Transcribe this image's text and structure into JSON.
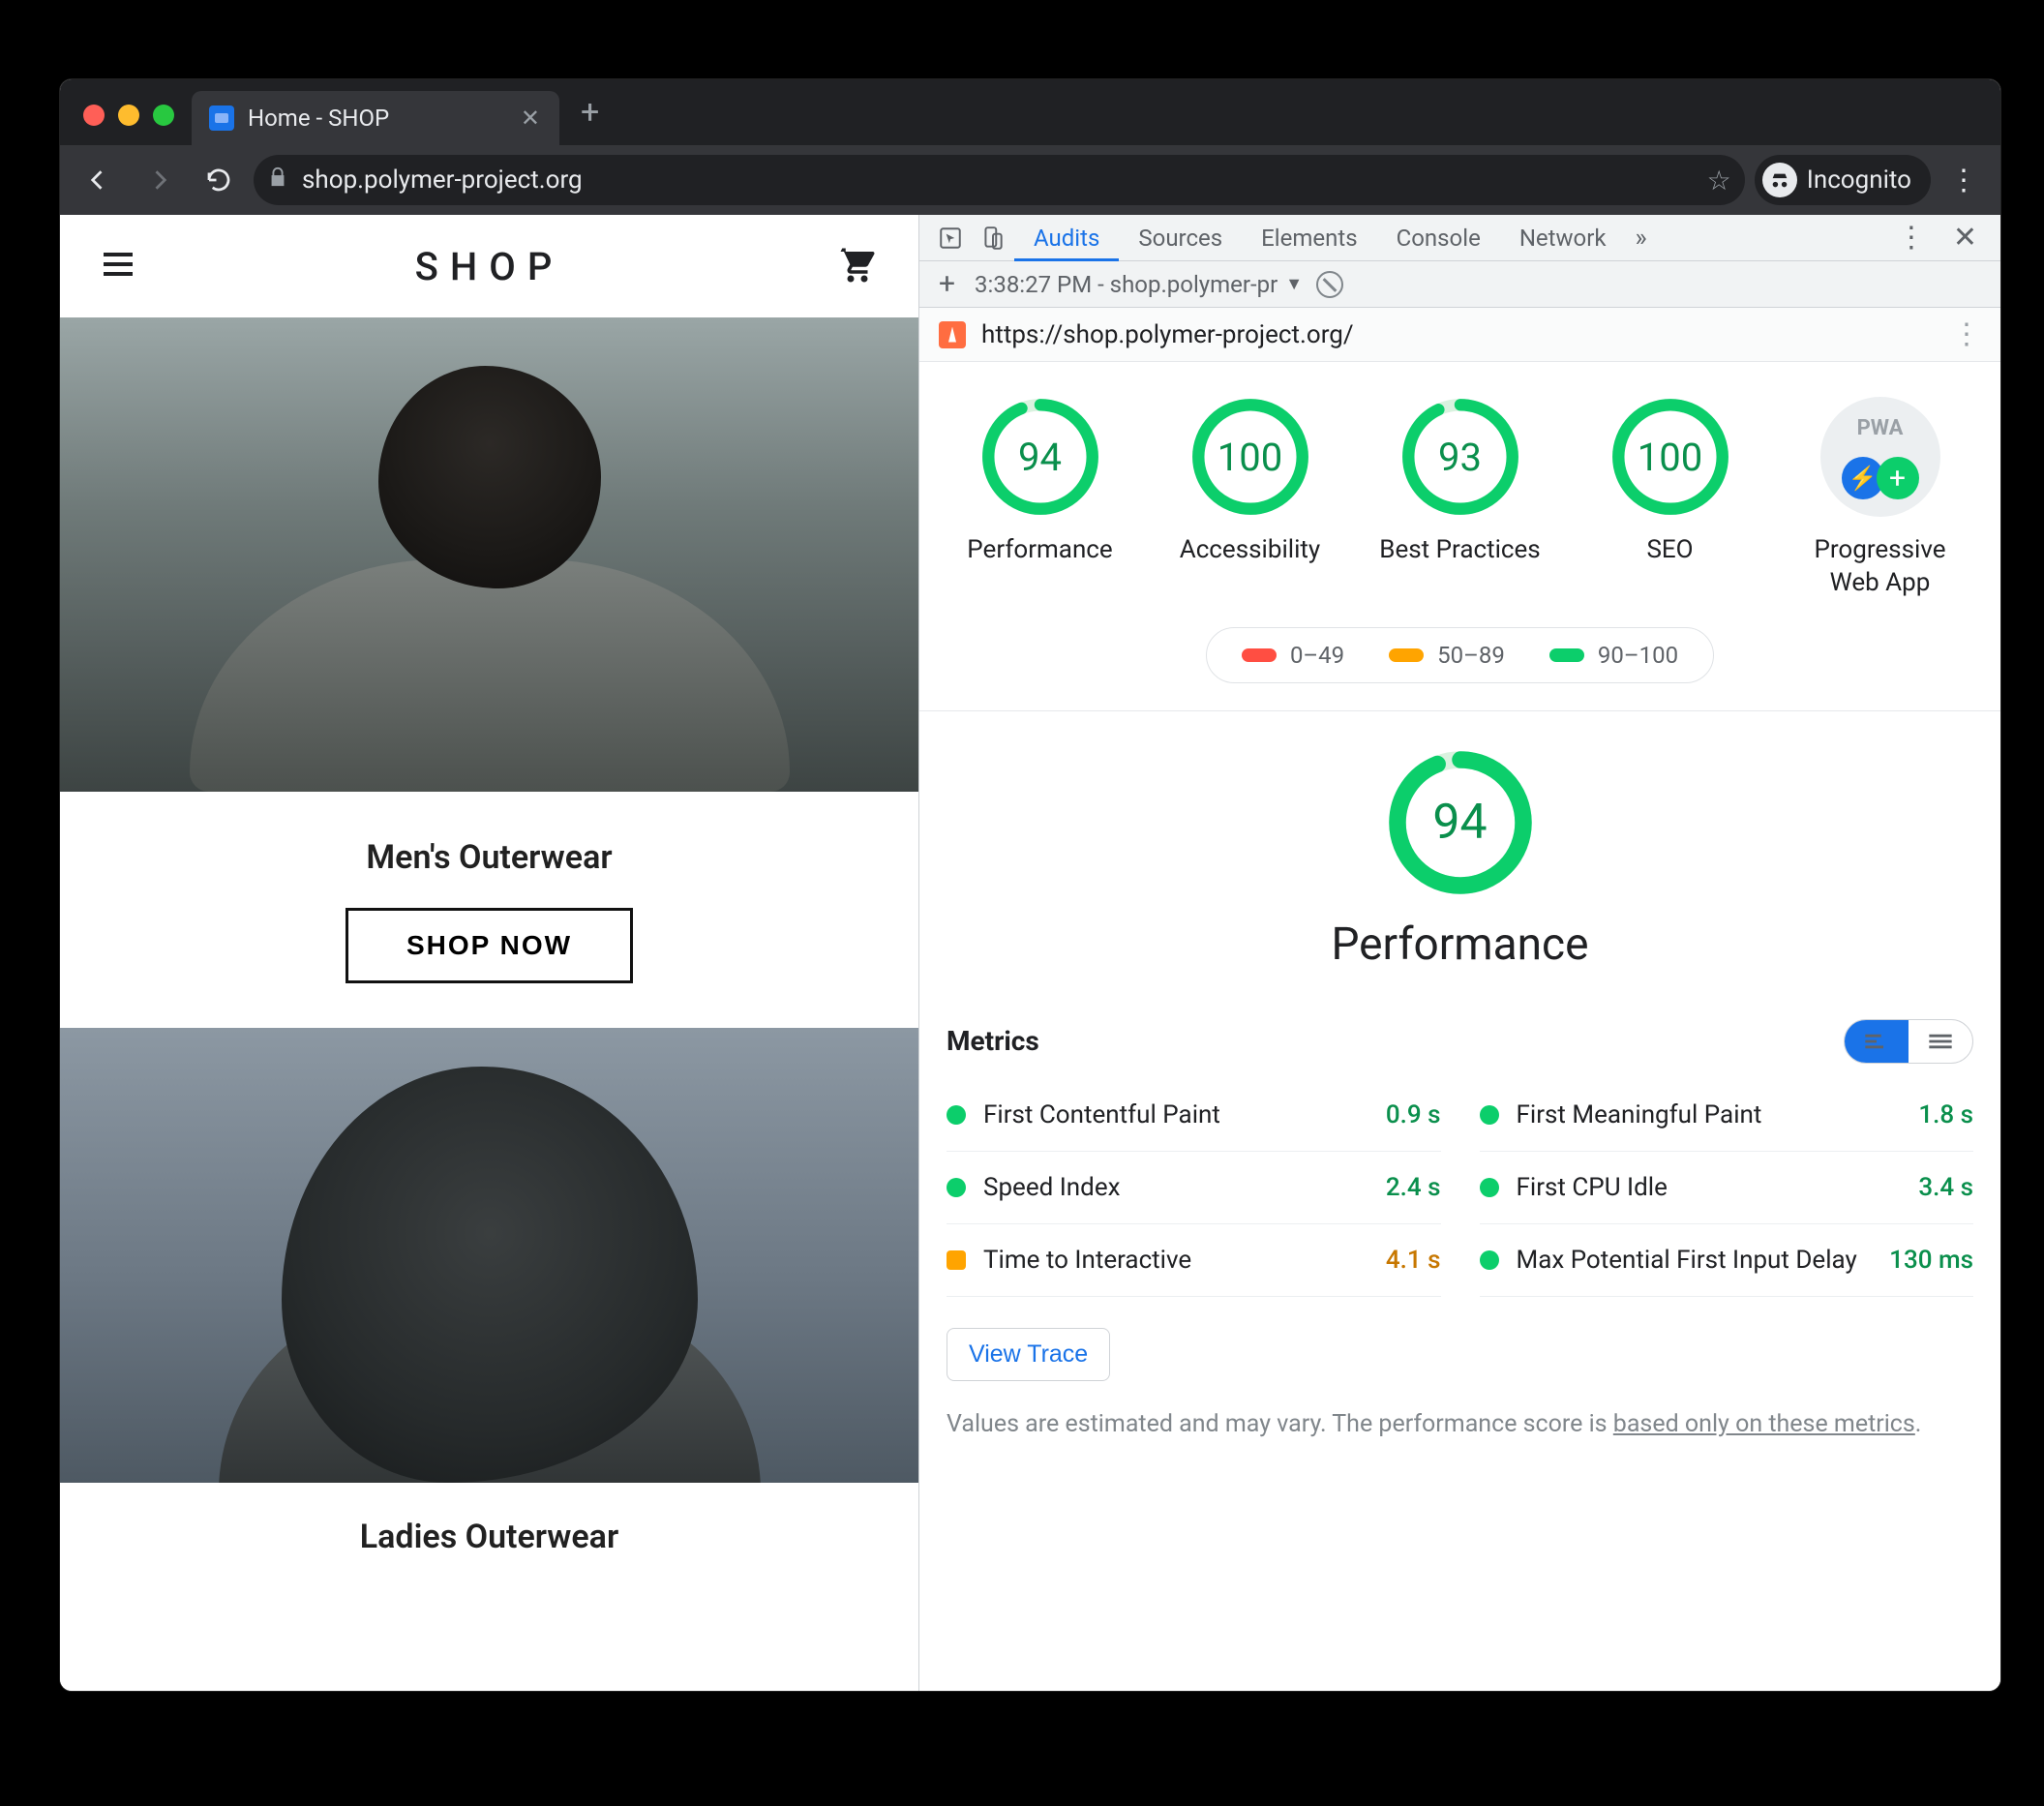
{
  "browser_tab": {
    "title": "Home - SHOP"
  },
  "omnibox": {
    "url": "shop.polymer-project.org"
  },
  "incognito_label": "Incognito",
  "page": {
    "title": "SHOP",
    "section1": "Men's Outerwear",
    "shop_now": "SHOP NOW",
    "section2": "Ladies Outerwear"
  },
  "devtools": {
    "tabs": [
      "Audits",
      "Sources",
      "Elements",
      "Console",
      "Network"
    ],
    "active_tab": "Audits",
    "run_label": "3:38:27 PM - shop.polymer-pr",
    "audited_url": "https://shop.polymer-project.org/",
    "scores": [
      {
        "label": "Performance",
        "value": 94
      },
      {
        "label": "Accessibility",
        "value": 100
      },
      {
        "label": "Best Practices",
        "value": 93
      },
      {
        "label": "SEO",
        "value": 100
      }
    ],
    "pwa_label": "Progressive Web App",
    "legend": [
      "0–49",
      "50–89",
      "90–100"
    ],
    "big_score_label": "Performance",
    "big_score_value": 94,
    "metrics_heading": "Metrics",
    "metrics": [
      {
        "name": "First Contentful Paint",
        "value": "0.9 s",
        "status": "green"
      },
      {
        "name": "First Meaningful Paint",
        "value": "1.8 s",
        "status": "green"
      },
      {
        "name": "Speed Index",
        "value": "2.4 s",
        "status": "green"
      },
      {
        "name": "First CPU Idle",
        "value": "3.4 s",
        "status": "green"
      },
      {
        "name": "Time to Interactive",
        "value": "4.1 s",
        "status": "orange"
      },
      {
        "name": "Max Potential First Input Delay",
        "value": "130 ms",
        "status": "green"
      }
    ],
    "view_trace": "View Trace",
    "disclaimer_pre": "Values are estimated and may vary. The performance score is ",
    "disclaimer_link": "based only on these metrics",
    "disclaimer_post": "."
  }
}
